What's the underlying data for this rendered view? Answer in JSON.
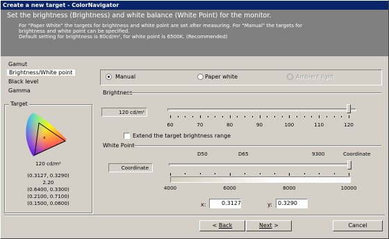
{
  "window": {
    "title": "Create a new target - ColorNavigator"
  },
  "header": {
    "main": "Set the brightness (Brightness) and white balance (White Point) for the monitor.",
    "lines": [
      "For \"Paper White\" the targets for brightness and white point are set after measuring. For \"Manual\" the targets for",
      "brightness and white point can be specified.",
      "Default setting for brightness is 80cd/m², for white point is 6500K. (Recommended)"
    ]
  },
  "sidebar": {
    "items": [
      {
        "label": "Gamut"
      },
      {
        "label": "Brightness/White point"
      },
      {
        "label": "Black level"
      },
      {
        "label": "Gamma"
      }
    ]
  },
  "target": {
    "title": "Target",
    "brightness": "120 cd/m²",
    "lines": [
      "(0.3127, 0.3290)",
      "2.20",
      "(0.6400, 0.3300)",
      "(0.2100, 0.7100)",
      "(0.1500, 0.0600)"
    ]
  },
  "mode": {
    "manual": "Manual",
    "paper": "Paper white",
    "ambient": "Ambient light",
    "selected": "manual"
  },
  "brightness": {
    "title": "Brightness",
    "value": "120 cd/m²",
    "ticks": [
      "60",
      "70",
      "80",
      "90",
      "100",
      "110",
      "120"
    ],
    "slider_value": 120,
    "extend_label": "Extend the target brightness range"
  },
  "white_point": {
    "title": "White Point",
    "coordinate_label": "Coordinate",
    "marks": [
      "D50",
      "D65",
      "9300",
      "Coordinate"
    ],
    "ticks": [
      "4000",
      "6000",
      "8000",
      "10000"
    ],
    "x_label": "x:",
    "x_value": "0.3127",
    "y_label": "y:",
    "y_value": "0.3290"
  },
  "buttons": {
    "back": "Back",
    "next": "Next",
    "cancel": "Cancel"
  },
  "colors": {
    "title_bar": "#0a246a",
    "header_bg": "#808080",
    "face": "#d4d0c8"
  }
}
